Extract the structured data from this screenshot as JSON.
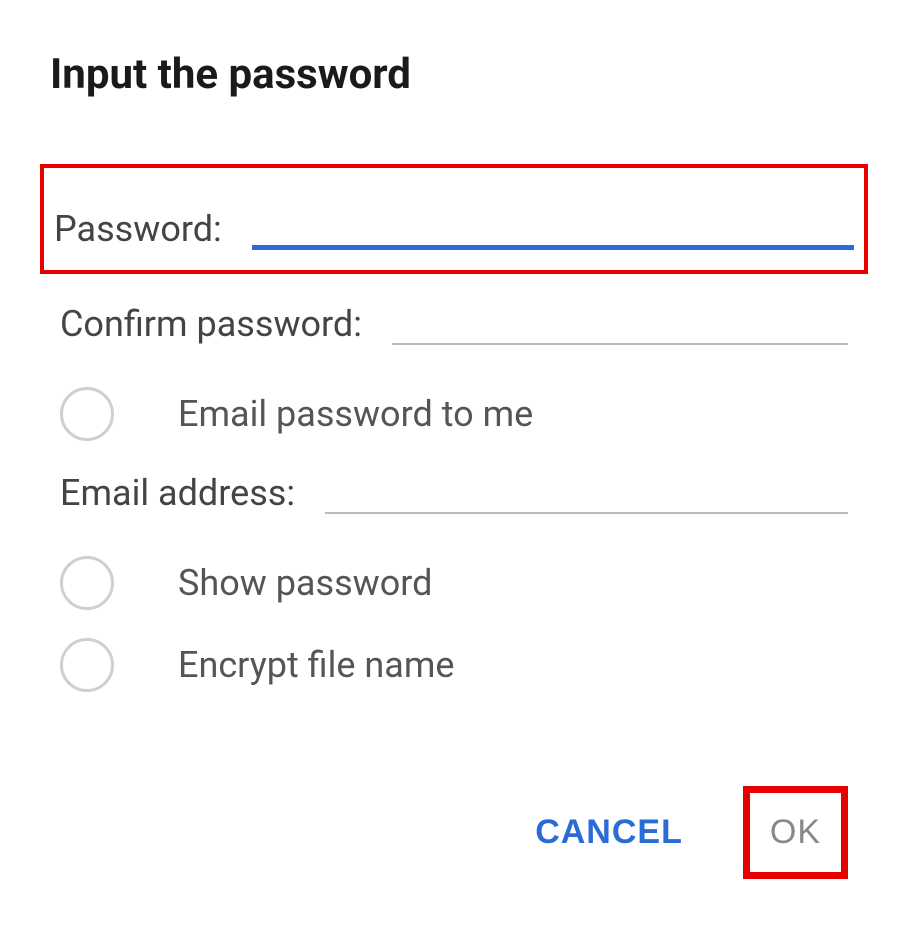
{
  "dialog": {
    "title": "Input the password",
    "fields": {
      "password_label": "Password:",
      "confirm_label": "Confirm password:",
      "email_label": "Email address:"
    },
    "checkboxes": {
      "email_me": "Email password to me",
      "show_password": "Show password",
      "encrypt_filename": "Encrypt file name"
    },
    "buttons": {
      "cancel": "CANCEL",
      "ok": "OK"
    }
  }
}
